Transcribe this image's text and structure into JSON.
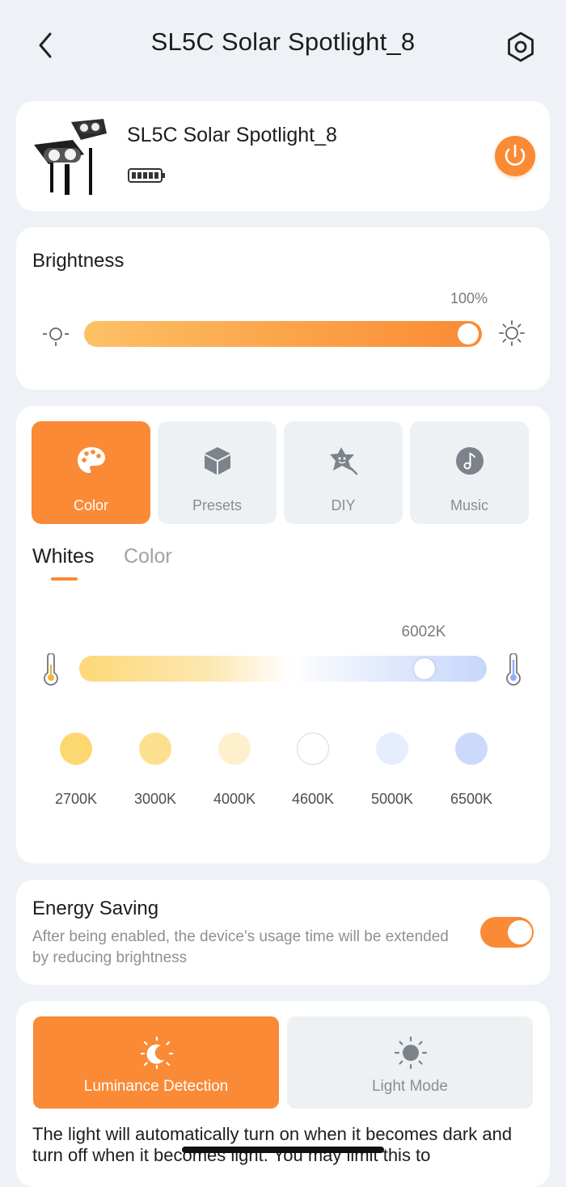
{
  "header": {
    "title": "SL5C Solar Spotlight_8",
    "back_icon": "chevron-left-icon",
    "settings_icon": "gear-icon"
  },
  "device": {
    "name": "SL5C Solar Spotlight_8",
    "battery_icon": "battery-full-icon",
    "power_icon": "power-icon"
  },
  "brightness": {
    "title": "Brightness",
    "value_label": "100%",
    "value": 100
  },
  "mode_tabs": [
    {
      "label": "Color",
      "icon": "palette-icon",
      "active": true
    },
    {
      "label": "Presets",
      "icon": "cube-icon",
      "active": false
    },
    {
      "label": "DIY",
      "icon": "star-face-icon",
      "active": false
    },
    {
      "label": "Music",
      "icon": "music-note-icon",
      "active": false
    }
  ],
  "sub_tabs": {
    "whites": "Whites",
    "color": "Color",
    "active": "whites"
  },
  "color_temp": {
    "value_label": "6002K",
    "value": 6002,
    "presets": [
      {
        "label": "2700K",
        "color": "#fdd870"
      },
      {
        "label": "3000K",
        "color": "#fde08f"
      },
      {
        "label": "4000K",
        "color": "#fef0cc"
      },
      {
        "label": "4600K",
        "color": "#ffffff"
      },
      {
        "label": "5000K",
        "color": "#e6eefd"
      },
      {
        "label": "6500K",
        "color": "#cbd9fb"
      }
    ]
  },
  "energy_saving": {
    "title": "Energy Saving",
    "description": "After being enabled, the device's usage time will be extended by reducing brightness",
    "enabled": true
  },
  "light_modes": [
    {
      "label": "Luminance Detection",
      "icon": "moon-sun-icon",
      "active": true
    },
    {
      "label": "Light Mode",
      "icon": "sun-icon",
      "active": false
    }
  ],
  "light_mode_desc": "The light will automatically turn on when it becomes dark and turn off when it becomes light. You may limit this to",
  "colors": {
    "accent": "#fa8a35",
    "background": "#eef2f6",
    "card": "#ffffff"
  }
}
